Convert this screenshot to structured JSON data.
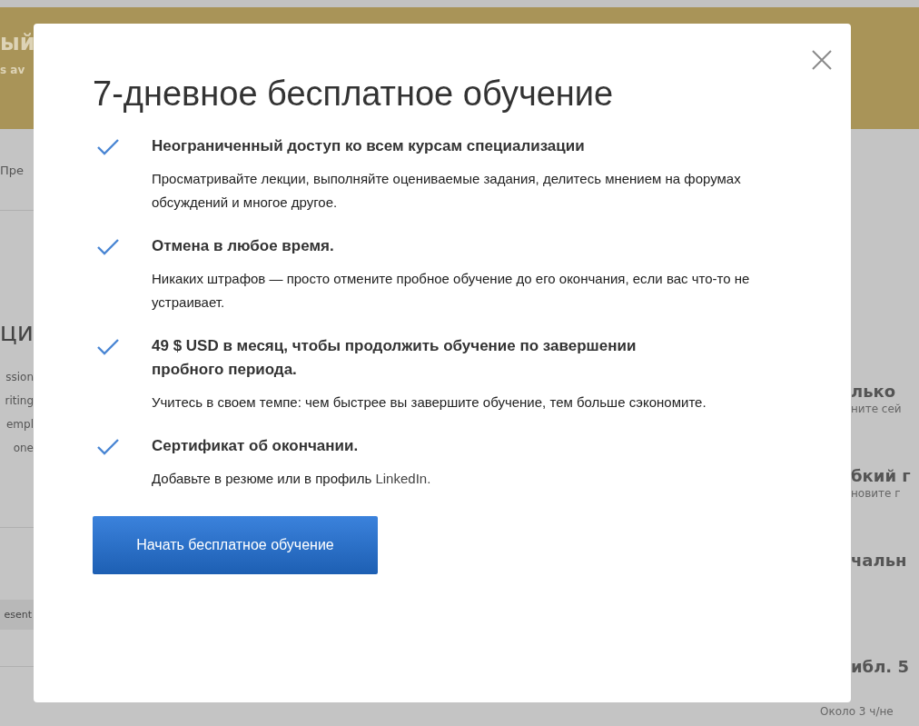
{
  "background": {
    "banner": [
      "ый",
      "s av"
    ],
    "left": {
      "tab": "Пре",
      "heading": "ци",
      "lines": [
        "ssion",
        "riting",
        "empl",
        "one"
      ],
      "chip": "esent"
    },
    "right": [
      {
        "title": "лько",
        "subtitle": "ните сей"
      },
      {
        "title": "бкий г",
        "subtitle": "новите г"
      },
      {
        "title": "чальн"
      },
      {
        "title": "ибл. 5",
        "subtitle": "Около 3 ч/не"
      }
    ]
  },
  "modal": {
    "title": "7-дневное бесплатное обучение",
    "features": [
      {
        "checked": true,
        "heading": "Неограниченный доступ ко всем курсам специализации",
        "text": "Просматривайте лекции, выполняйте оцениваемые задания, делитесь мнением на форумах обсуждений и многое другое."
      },
      {
        "checked": true,
        "heading": "Отмена в любое время.",
        "text": "Никаких штрафов — просто отмените пробное обучение до его окончания, если вас что-то не устраивает."
      },
      {
        "checked": true,
        "heading": "49 $ USD в месяц, чтобы продолжить обучение по завершении пробного периода.",
        "text": "Учитесь в своем темпе: чем быстрее вы завершите обучение, тем больше сэкономите."
      },
      {
        "checked": true,
        "heading": "Сертификат об окончании.",
        "text": "Добавьте в резюме или в профиль",
        "link": "LinkedIn."
      }
    ],
    "button": "Начать бесплатное обучение"
  }
}
